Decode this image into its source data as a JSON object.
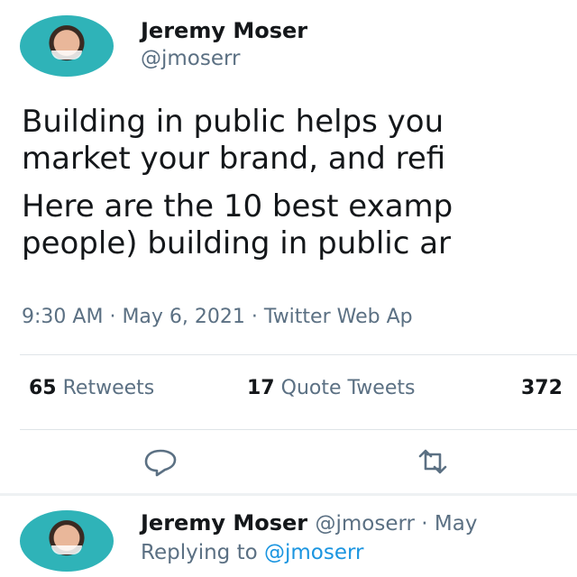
{
  "tweet": {
    "author_name": "Jeremy Moser",
    "author_handle": "@jmoserr",
    "text_line1": "Building in public helps you",
    "text_line2": "market your brand, and refi",
    "text_line3": "Here are the 10 best examp",
    "text_line4": "people) building in public ar",
    "time": "9:30 AM",
    "date": "May 6, 2021",
    "source": "Twitter Web Ap",
    "retweets_count": "65",
    "retweets_label": "Retweets",
    "quotes_count": "17",
    "quotes_label": "Quote Tweets",
    "likes_count": "372"
  },
  "actions": {
    "reply_icon": "reply-icon",
    "retweet_icon": "retweet-icon"
  },
  "reply": {
    "author_name": "Jeremy Moser",
    "author_handle": "@jmoserr",
    "date": "May",
    "replying_prefix": "Replying to",
    "replying_handle": "@jmoserr"
  },
  "colors": {
    "text": "#14171a",
    "secondary": "#5b7083",
    "link": "#1b95e0",
    "avatar_bg": "#2fb3b8"
  }
}
